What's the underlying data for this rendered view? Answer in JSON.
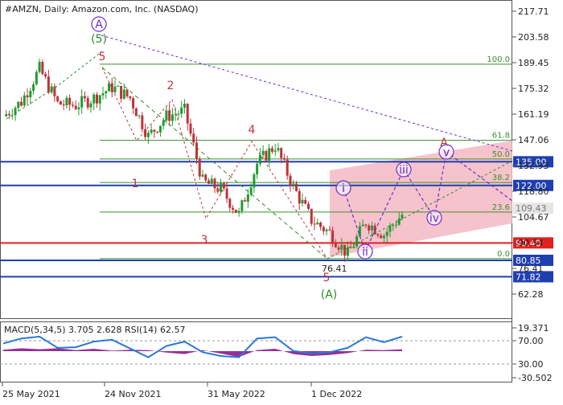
{
  "header": {
    "title": "#AMZN, Daily:  Amazon.com, Inc. (NASDAQ)"
  },
  "chart_data": [
    {
      "type": "line",
      "title": "#AMZN, Daily:  Amazon.com, Inc. (NASDAQ)",
      "ylim": [
        55,
        222
      ],
      "y_ticks": [
        "217.71",
        "203.58",
        "189.45",
        "175.32",
        "161.19",
        "147.06",
        "132.93",
        "118.80",
        "104.67",
        "90.54",
        "76.41",
        "62.28"
      ],
      "x_ticks": [
        "25 May 2021",
        "24 Nov 2021",
        "31 May 2022",
        "1 Dec 2022"
      ],
      "current_price": "109.43",
      "series": [
        {
          "type": "candlestick",
          "x": [
            "May-2021",
            "Jun-2021",
            "Jul-2021",
            "Aug-2021",
            "Sep-2021",
            "Oct-2021",
            "Nov-2021",
            "Dec-2021",
            "Jan-2022",
            "Feb-2022",
            "Mar-2022",
            "Apr-2022",
            "May-2022",
            "Jun-2022",
            "Jul-2022",
            "Aug-2022",
            "Sep-2022",
            "Oct-2022",
            "Nov-2022",
            "Dec-2022",
            "Jan-2023",
            "Feb-2023",
            "Mar-2023"
          ],
          "close": [
            160,
            168,
            186,
            167,
            166,
            170,
            176,
            170,
            149,
            160,
            163,
            124,
            120,
            106,
            134,
            144,
            121,
            103,
            96,
            84,
            102,
            95,
            106
          ]
        }
      ],
      "levels": [
        {
          "label": "135.00",
          "value": 135.0,
          "color": "#1f3fb0"
        },
        {
          "label": "122.00",
          "value": 122.0,
          "color": "#1f3fb0"
        },
        {
          "label": "90.40",
          "value": 90.4,
          "color": "#e02020"
        },
        {
          "label": "80.85",
          "value": 80.85,
          "color": "#1f3fb0"
        },
        {
          "label": "71.82",
          "value": 71.82,
          "color": "#1f3fb0"
        }
      ],
      "fib_levels": [
        {
          "label": "100.0",
          "value": 188.6
        },
        {
          "label": "61.8",
          "value": 146.8
        },
        {
          "label": "50.0",
          "value": 136.5
        },
        {
          "label": "38.2",
          "value": 123.6
        },
        {
          "label": "23.6",
          "value": 107.4
        },
        {
          "label": "0.0",
          "value": 81.8
        }
      ],
      "wave_labels": [
        "A",
        "(5)",
        "5",
        "2",
        "1",
        "4",
        "3",
        "5",
        "(A)",
        "A",
        "i",
        "ii",
        "iii",
        "iv",
        "v"
      ],
      "hidden_tick": "76.41"
    },
    {
      "type": "line",
      "title": "MACD(5,34,5) 3.705 2.628 RSI(14) 62.57",
      "y_ticks": [
        "19.371",
        "70.00",
        "30.00",
        "-30.502"
      ],
      "series": [
        {
          "name": "MACD",
          "values": [
            3,
            6,
            4,
            6,
            2,
            5,
            1,
            3,
            2,
            -3,
            -6,
            2,
            -5,
            -12,
            2,
            5,
            -6,
            -10,
            -8,
            -4,
            3,
            2,
            4
          ]
        },
        {
          "name": "RSI",
          "values": [
            52,
            60,
            63,
            45,
            46,
            55,
            58,
            44,
            30,
            48,
            55,
            38,
            32,
            30,
            60,
            62,
            40,
            36,
            38,
            45,
            62,
            54,
            63
          ]
        }
      ]
    }
  ],
  "colors": {
    "candle_up": "#1f9c2e",
    "candle_down": "#c0323a",
    "channel": "#f4b8c3",
    "purple": "#6a2bd1",
    "fib": "#3a8f2a",
    "macd_hist": "#8b1a8b",
    "rsi": "#2a78d8"
  }
}
